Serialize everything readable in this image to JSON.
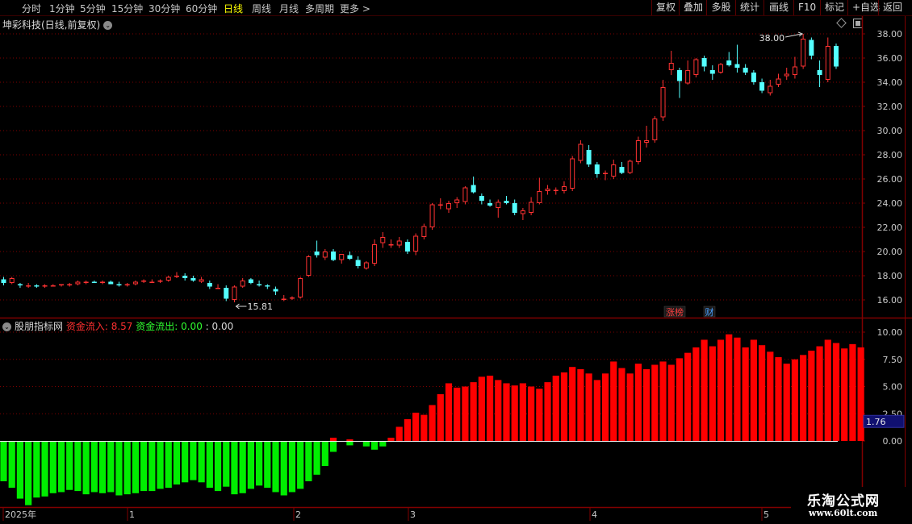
{
  "toolbar": {
    "periods": [
      "分时",
      "1分钟",
      "5分钟",
      "15分钟",
      "30分钟",
      "60分钟",
      "日线",
      "周线",
      "月线",
      "多周期",
      "更多 >"
    ],
    "active_period": "日线",
    "right_buttons": [
      "复权",
      "叠加",
      "多股",
      "统计",
      "画线",
      "F10",
      "标记",
      "+自选",
      "返回"
    ]
  },
  "stock": {
    "title": "坤彩科技(日线,前复权)"
  },
  "price_panel": {
    "high_label": "38.00",
    "low_label": "15.81",
    "badges": [
      {
        "text": "涨榜",
        "color": "#ff4040"
      },
      {
        "text": "财",
        "color": "#4aa0ff"
      }
    ]
  },
  "indicator": {
    "name": "股朋指标网",
    "inflow_label": "资金流入: 8.57",
    "outflow_label": "资金流出: 0.00",
    "extra_label": ": 0.00",
    "current_value": "1.76"
  },
  "timeline": {
    "labels": [
      "2025年",
      "1",
      "2",
      "3",
      "4",
      "5"
    ]
  },
  "watermark": {
    "title": "乐淘公式网",
    "url": "www.60lt.com"
  },
  "colors": {
    "up": "#ff3232",
    "down": "#54ffff",
    "inflow": "#ff0000",
    "outflow": "#00ee00",
    "grid": "#800000",
    "axis": "#c8c8c8"
  },
  "chart_data": [
    {
      "type": "candlestick",
      "title": "坤彩科技(日线,前复权)",
      "ylim": [
        15,
        39
      ],
      "yticks": [
        "16.00",
        "18.00",
        "20.00",
        "22.00",
        "24.00",
        "26.00",
        "28.00",
        "30.00",
        "32.00",
        "34.00",
        "36.00",
        "38.00"
      ],
      "ohlc": [
        [
          17.7,
          17.9,
          17.2,
          17.4
        ],
        [
          17.4,
          17.9,
          17.3,
          17.8
        ],
        [
          17.3,
          17.4,
          17.0,
          17.2
        ],
        [
          17.1,
          17.4,
          17.0,
          17.2
        ],
        [
          17.2,
          17.3,
          17.0,
          17.1
        ],
        [
          17.1,
          17.3,
          17.0,
          17.2
        ],
        [
          17.2,
          17.3,
          17.1,
          17.2
        ],
        [
          17.2,
          17.3,
          17.1,
          17.3
        ],
        [
          17.2,
          17.4,
          17.1,
          17.3
        ],
        [
          17.3,
          17.6,
          17.2,
          17.5
        ],
        [
          17.4,
          17.6,
          17.3,
          17.5
        ],
        [
          17.5,
          17.6,
          17.4,
          17.4
        ],
        [
          17.4,
          17.6,
          17.3,
          17.5
        ],
        [
          17.5,
          17.6,
          17.4,
          17.3
        ],
        [
          17.3,
          17.5,
          17.1,
          17.2
        ],
        [
          17.2,
          17.4,
          17.1,
          17.3
        ],
        [
          17.3,
          17.6,
          17.2,
          17.5
        ],
        [
          17.5,
          17.7,
          17.4,
          17.6
        ],
        [
          17.5,
          17.7,
          17.4,
          17.5
        ],
        [
          17.5,
          17.7,
          17.4,
          17.6
        ],
        [
          17.6,
          18.0,
          17.5,
          17.9
        ],
        [
          17.9,
          18.3,
          17.8,
          18.0
        ],
        [
          18.0,
          18.2,
          17.6,
          17.8
        ],
        [
          17.8,
          18.0,
          17.5,
          17.6
        ],
        [
          17.5,
          17.9,
          17.4,
          17.7
        ],
        [
          17.4,
          17.6,
          16.9,
          17.1
        ],
        [
          17.0,
          17.3,
          16.9,
          17.0
        ],
        [
          17.0,
          17.2,
          15.9,
          16.1
        ],
        [
          16.0,
          17.2,
          15.8,
          17.1
        ],
        [
          17.1,
          17.8,
          17.0,
          17.6
        ],
        [
          17.7,
          17.8,
          17.3,
          17.4
        ],
        [
          17.3,
          17.6,
          17.1,
          17.2
        ],
        [
          17.2,
          17.3,
          16.9,
          17.1
        ],
        [
          16.9,
          17.1,
          16.4,
          16.7
        ],
        [
          16.1,
          16.4,
          15.9,
          16.1
        ],
        [
          16.1,
          16.3,
          16.0,
          16.2
        ],
        [
          16.2,
          17.9,
          16.1,
          17.8
        ],
        [
          18.0,
          19.7,
          17.9,
          19.6
        ],
        [
          20.0,
          20.9,
          19.5,
          19.7
        ],
        [
          19.5,
          20.2,
          19.3,
          20.0
        ],
        [
          20.0,
          20.2,
          19.2,
          19.3
        ],
        [
          19.3,
          19.8,
          19.0,
          19.8
        ],
        [
          19.7,
          20.0,
          19.3,
          19.4
        ],
        [
          19.3,
          19.6,
          18.6,
          18.8
        ],
        [
          18.6,
          19.2,
          18.5,
          19.1
        ],
        [
          19.0,
          21.0,
          18.8,
          20.6
        ],
        [
          20.7,
          21.6,
          20.3,
          21.2
        ],
        [
          20.5,
          21.0,
          20.3,
          20.6
        ],
        [
          20.5,
          21.2,
          20.3,
          20.9
        ],
        [
          20.8,
          21.0,
          19.8,
          20.0
        ],
        [
          20.0,
          21.5,
          19.7,
          21.3
        ],
        [
          21.2,
          22.3,
          21.0,
          22.1
        ],
        [
          22.0,
          24.0,
          21.8,
          23.9
        ],
        [
          23.8,
          24.4,
          23.5,
          23.9
        ],
        [
          23.5,
          24.2,
          23.2,
          24.0
        ],
        [
          24.0,
          24.5,
          23.6,
          24.3
        ],
        [
          24.1,
          25.4,
          23.9,
          25.3
        ],
        [
          25.5,
          26.2,
          24.8,
          24.9
        ],
        [
          24.6,
          24.8,
          23.9,
          24.2
        ],
        [
          24.0,
          24.3,
          23.7,
          23.8
        ],
        [
          23.6,
          24.3,
          22.8,
          24.1
        ],
        [
          24.2,
          24.6,
          23.9,
          24.0
        ],
        [
          24.0,
          24.3,
          23.0,
          23.2
        ],
        [
          23.1,
          23.6,
          22.6,
          23.4
        ],
        [
          23.2,
          24.5,
          23.0,
          24.1
        ],
        [
          24.0,
          26.1,
          23.9,
          25.0
        ],
        [
          25.0,
          25.5,
          24.7,
          25.2
        ],
        [
          25.0,
          25.3,
          24.7,
          25.1
        ],
        [
          25.0,
          25.8,
          24.8,
          25.4
        ],
        [
          25.2,
          27.9,
          25.0,
          27.7
        ],
        [
          27.5,
          29.2,
          27.3,
          28.9
        ],
        [
          28.4,
          28.8,
          27.0,
          27.2
        ],
        [
          27.2,
          27.4,
          26.1,
          26.4
        ],
        [
          26.4,
          26.7,
          25.9,
          26.5
        ],
        [
          26.2,
          27.6,
          26.0,
          27.2
        ],
        [
          27.0,
          27.4,
          26.4,
          26.5
        ],
        [
          26.5,
          27.6,
          26.4,
          27.5
        ],
        [
          27.4,
          29.5,
          27.2,
          29.2
        ],
        [
          29.0,
          30.4,
          28.6,
          29.2
        ],
        [
          29.2,
          31.2,
          29.0,
          31.0
        ],
        [
          31.1,
          34.2,
          30.8,
          33.6
        ],
        [
          35.0,
          36.6,
          34.6,
          35.6
        ],
        [
          35.0,
          35.2,
          32.7,
          34.1
        ],
        [
          33.9,
          35.8,
          33.8,
          35.0
        ],
        [
          34.6,
          36.0,
          34.4,
          35.9
        ],
        [
          36.0,
          36.2,
          34.9,
          35.3
        ],
        [
          35.0,
          35.4,
          34.2,
          34.7
        ],
        [
          34.8,
          35.6,
          34.7,
          35.5
        ],
        [
          35.8,
          36.5,
          35.3,
          35.4
        ],
        [
          35.5,
          37.1,
          34.8,
          35.2
        ],
        [
          35.2,
          35.5,
          34.6,
          34.8
        ],
        [
          34.8,
          35.0,
          33.8,
          34.0
        ],
        [
          34.0,
          34.3,
          33.1,
          33.3
        ],
        [
          33.1,
          34.2,
          32.9,
          33.7
        ],
        [
          33.8,
          34.7,
          33.6,
          34.3
        ],
        [
          34.5,
          35.2,
          34.2,
          34.7
        ],
        [
          34.6,
          36.1,
          34.3,
          35.3
        ],
        [
          35.3,
          38.0,
          35.1,
          37.6
        ],
        [
          37.5,
          37.7,
          35.9,
          36.2
        ],
        [
          35.0,
          35.8,
          33.6,
          34.6
        ],
        [
          34.2,
          37.7,
          34.0,
          37.0
        ],
        [
          37.0,
          37.2,
          35.1,
          35.3
        ]
      ]
    },
    {
      "type": "bar",
      "title": "股朋指标网",
      "ylim": [
        -5.8,
        10.5
      ],
      "yticks": [
        "0.00",
        "2.50",
        "5.00",
        "7.50",
        "10.00"
      ],
      "series": [
        {
          "name": "资金流入",
          "values": [
            0,
            0,
            0,
            0,
            0,
            0,
            0,
            0,
            0,
            0,
            0,
            0,
            0,
            0,
            0,
            0,
            0,
            0,
            0,
            0,
            0,
            0,
            0,
            0,
            0,
            0,
            0,
            0,
            0,
            0,
            0,
            0,
            0,
            0,
            0,
            0,
            0,
            0,
            0,
            0,
            0.3,
            0,
            0.15,
            0,
            0,
            0,
            0,
            0.3,
            1.3,
            2.0,
            2.6,
            2.4,
            3.3,
            4.3,
            5.3,
            4.9,
            5.0,
            5.4,
            5.9,
            6.0,
            5.6,
            5.3,
            5.1,
            5.3,
            5.0,
            4.8,
            5.4,
            6.0,
            6.3,
            6.8,
            6.6,
            6.2,
            5.6,
            6.2,
            7.3,
            6.7,
            6.2,
            7.1,
            6.6,
            7.0,
            7.3,
            7.0,
            7.6,
            8.1,
            8.6,
            9.3,
            8.7,
            9.3,
            9.8,
            9.5,
            8.6,
            9.3,
            8.8,
            8.2,
            7.7,
            7.1,
            7.5,
            7.9,
            8.3,
            8.7,
            9.3,
            9.0,
            8.5,
            8.9,
            8.6
          ]
        },
        {
          "name": "资金流出",
          "values": [
            -3.7,
            -4.3,
            -5.3,
            -5.9,
            -5.2,
            -5.1,
            -4.8,
            -4.7,
            -4.5,
            -4.6,
            -4.9,
            -4.7,
            -4.8,
            -4.7,
            -5.0,
            -4.9,
            -4.8,
            -4.6,
            -4.6,
            -4.4,
            -4.3,
            -4.0,
            -3.8,
            -3.6,
            -3.8,
            -4.3,
            -4.6,
            -4.2,
            -4.9,
            -4.8,
            -4.4,
            -4.1,
            -4.3,
            -4.7,
            -5.0,
            -4.7,
            -4.4,
            -3.7,
            -3.1,
            -2.3,
            -1.0,
            0,
            -0.4,
            0,
            -0.5,
            -0.8,
            -0.5,
            0,
            0,
            0,
            0,
            0,
            0,
            0,
            0,
            0,
            0,
            0,
            0,
            0,
            0,
            0,
            0,
            0,
            0,
            0,
            0,
            0,
            0,
            0,
            0,
            0,
            0,
            0,
            0,
            0,
            0,
            0,
            0,
            0,
            0,
            0,
            0,
            0,
            0,
            0,
            0,
            0,
            0,
            0,
            0,
            0,
            0,
            0,
            0,
            0,
            0,
            0,
            0,
            0,
            0,
            0,
            0,
            0
          ]
        }
      ]
    }
  ]
}
